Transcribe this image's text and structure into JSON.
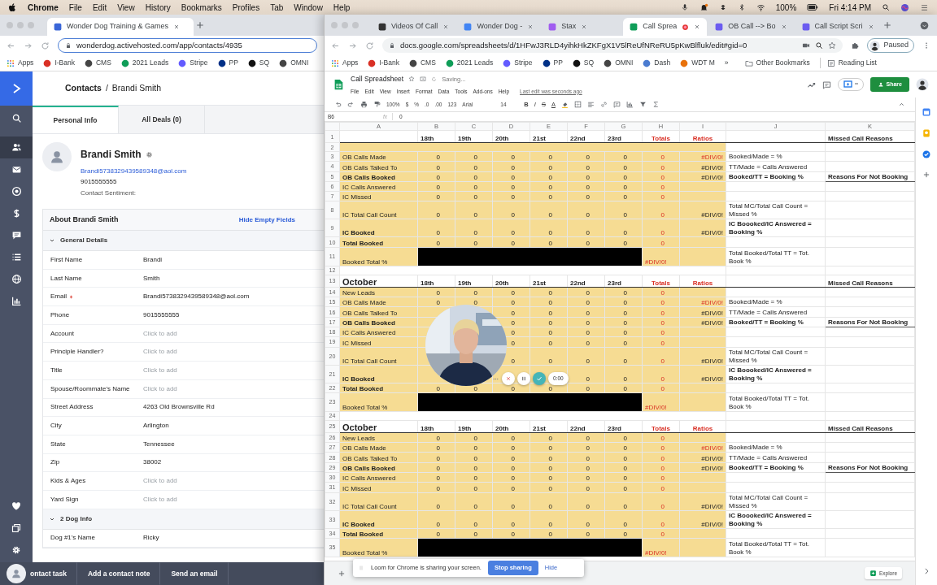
{
  "menubar": {
    "app": "Chrome",
    "menus": [
      "File",
      "Edit",
      "View",
      "History",
      "Bookmarks",
      "Profiles",
      "Tab",
      "Window",
      "Help"
    ],
    "battery": "100%",
    "clock": "Fri 4:14 PM"
  },
  "left_window": {
    "tabs": [
      {
        "title": "Wonder Dog Training & Games",
        "selected": true
      }
    ],
    "url": "wonderdog.activehosted.com/app/contacts/4935",
    "bookmarks": [
      {
        "label": "Apps",
        "kind": "apps"
      },
      {
        "label": "I-Bank",
        "kind": "site",
        "color": "#d93025"
      },
      {
        "label": "CMS",
        "kind": "site",
        "color": "#444444"
      },
      {
        "label": "2021 Leads",
        "kind": "site",
        "color": "#0f9d58"
      },
      {
        "label": "Stripe",
        "kind": "site",
        "color": "#635bff"
      },
      {
        "label": "PP",
        "kind": "site",
        "color": "#003087"
      },
      {
        "label": "SQ",
        "kind": "site",
        "color": "#111111"
      },
      {
        "label": "OMNI",
        "kind": "site",
        "color": "#444444"
      }
    ],
    "breadcrumb": {
      "parent": "Contacts",
      "separator": "/",
      "current": "Brandi Smith"
    },
    "nav_tabs": [
      {
        "label": "Personal Info",
        "selected": true
      },
      {
        "label": "All Deals (0)",
        "selected": false
      }
    ],
    "contact": {
      "name": "Brandi Smith",
      "email": "Brandi5738329439589348@aol.com",
      "phone": "9015555555",
      "sentiment": "Contact Sentiment:"
    },
    "about": {
      "title": "About Brandi Smith",
      "action": "Hide Empty Fields"
    },
    "sections": [
      {
        "title": "General Details",
        "expanded": true,
        "fields": [
          {
            "label": "First Name",
            "value": "Brandi",
            "required": false
          },
          {
            "label": "Last Name",
            "value": "Smith",
            "required": false
          },
          {
            "label": "Email",
            "value": "Brandi5738329439589348@aol.com",
            "required": true
          },
          {
            "label": "Phone",
            "value": "9015555555",
            "required": false
          },
          {
            "label": "Account",
            "placeholder": "Click to add",
            "required": false
          },
          {
            "label": "Principle Handler?",
            "placeholder": "Click to add",
            "required": false
          },
          {
            "label": "Title",
            "placeholder": "Click to add",
            "required": false
          },
          {
            "label": "Spouse/Roommate's Name",
            "placeholder": "Click to add",
            "required": false
          },
          {
            "label": "Street Address",
            "value": "4263 Old Brownsville Rd",
            "required": false
          },
          {
            "label": "City",
            "value": "Arlington",
            "required": false
          },
          {
            "label": "State",
            "value": "Tennessee",
            "required": false
          },
          {
            "label": "Zip",
            "value": "38002",
            "required": false
          },
          {
            "label": "Kids & Ages",
            "placeholder": "Click to add",
            "required": false
          },
          {
            "label": "Yard Sign",
            "placeholder": "Click to add",
            "required": false
          }
        ]
      },
      {
        "title": "2 Dog Info",
        "expanded": true,
        "fields": [
          {
            "label": "Dog #1's Name",
            "value": "Ricky",
            "required": false
          }
        ]
      }
    ],
    "footer_actions": [
      "ontact task",
      "Add a contact note",
      "Send an email"
    ]
  },
  "right_window": {
    "tabs": [
      {
        "title": "Videos Of Call",
        "selected": false,
        "recording": false
      },
      {
        "title": "Wonder Dog -",
        "selected": false,
        "recording": false
      },
      {
        "title": "Stax",
        "selected": false,
        "recording": false
      },
      {
        "title": "Call Sprea",
        "selected": true,
        "recording": true
      },
      {
        "title": "OB Call --> Bo",
        "selected": false,
        "recording": false
      },
      {
        "title": "Call Script Scri",
        "selected": false,
        "recording": false
      }
    ],
    "url": "docs.google.com/spreadsheets/d/1HFwJ3RLD4yihkHkZKFgX1V5lReUfNReRU5pKwBlfluk/edit#gid=0",
    "profile_status": "Paused",
    "bookmarks": [
      {
        "label": "Apps",
        "kind": "apps"
      },
      {
        "label": "I-Bank",
        "kind": "site",
        "color": "#d93025"
      },
      {
        "label": "CMS",
        "kind": "site",
        "color": "#444444"
      },
      {
        "label": "2021 Leads",
        "kind": "site",
        "color": "#0f9d58"
      },
      {
        "label": "Stripe",
        "kind": "site",
        "color": "#635bff"
      },
      {
        "label": "PP",
        "kind": "site",
        "color": "#003087"
      },
      {
        "label": "SQ",
        "kind": "site",
        "color": "#111111"
      },
      {
        "label": "OMNI",
        "kind": "site",
        "color": "#444444"
      },
      {
        "label": "Dash",
        "kind": "site",
        "color": "#4a7bd0"
      },
      {
        "label": "WDT M",
        "kind": "site",
        "color": "#e8710a"
      }
    ],
    "more_bookmarks": "»",
    "other_bookmarks": "Other Bookmarks",
    "reading_list": "Reading List",
    "sheet": {
      "title": "Call Spreadsheet",
      "status": "Saving...",
      "menus": [
        "File",
        "Edit",
        "View",
        "Insert",
        "Format",
        "Data",
        "Tools",
        "Add-ons",
        "Help"
      ],
      "last_edit": "Last edit was seconds ago",
      "share": "Share",
      "toolbar": {
        "zoom": "100%",
        "formats": [
          "$",
          "%",
          ".0",
          ".00",
          "123"
        ],
        "font": "Arial",
        "size": "14",
        "styles": [
          "B",
          "I",
          "S",
          "A"
        ]
      },
      "cell_ref": "B6",
      "fx": "fx",
      "formula": "0",
      "columns": [
        "A",
        "B",
        "C",
        "D",
        "E",
        "F",
        "G",
        "H",
        "I",
        "J",
        "K"
      ],
      "rows": [
        {
          "kind": "header",
          "n": "1",
          "days": [
            "18th",
            "19th",
            "20th",
            "21st",
            "22nd",
            "23rd"
          ],
          "totals": "Totals",
          "ratios": "Ratios",
          "reason": "Missed Call Reasons"
        },
        {
          "kind": "blank",
          "n": "2",
          "shaded": true
        },
        {
          "kind": "data",
          "n": "3",
          "label": "OB Calls Made",
          "bold": false,
          "values": [
            "0",
            "0",
            "0",
            "0",
            "0",
            "0"
          ],
          "total": "0",
          "ratio": "#DIV/0!",
          "ratio_alert": true,
          "note": "Booked/Made = %",
          "note_bold": false
        },
        {
          "kind": "data",
          "n": "4",
          "label": "OB Calls Talked To",
          "bold": false,
          "values": [
            "0",
            "0",
            "0",
            "0",
            "0",
            "0"
          ],
          "total": "0",
          "ratio": "#DIV/0!",
          "ratio_alert": false,
          "note": "TT/Made = Calls Answered",
          "note_bold": false
        },
        {
          "kind": "data",
          "n": "5",
          "label": "OB Calls Booked",
          "bold": true,
          "values": [
            "0",
            "0",
            "0",
            "0",
            "0",
            "0"
          ],
          "total": "0",
          "ratio": "#DIV/0!",
          "ratio_alert": false,
          "note": "Booked/TT = Booking %",
          "note_bold": true,
          "reason": "Reasons For Not Booking"
        },
        {
          "kind": "data",
          "n": "6",
          "label": "IC Calls Answered",
          "bold": false,
          "values": [
            "0",
            "0",
            "0",
            "0",
            "0",
            "0"
          ],
          "total": "0"
        },
        {
          "kind": "data",
          "n": "7",
          "label": "IC Missed",
          "bold": false,
          "values": [
            "0",
            "0",
            "0",
            "0",
            "0",
            "0"
          ],
          "total": "0"
        },
        {
          "kind": "tall",
          "n": "8",
          "label": "IC Total Call Count",
          "bold": false,
          "values": [
            "0",
            "0",
            "0",
            "0",
            "0",
            "0"
          ],
          "total": "0",
          "ratio": "#DIV/0!",
          "ratio_alert": false,
          "note": "Total MC/Total Call Count = Missed %",
          "note_bold": false
        },
        {
          "kind": "tall",
          "n": "9",
          "label": "IC Booked",
          "bold": true,
          "values": [
            "0",
            "0",
            "0",
            "0",
            "0",
            "0"
          ],
          "total": "0",
          "ratio": "#DIV/0!",
          "ratio_alert": false,
          "note": "IC Boooked/IC Answered = Booking %",
          "note_bold": true
        },
        {
          "kind": "data",
          "n": "10",
          "label": "Total Booked",
          "bold": true,
          "values": [
            "0",
            "0",
            "0",
            "0",
            "0",
            "0"
          ],
          "total": "0"
        },
        {
          "kind": "percent",
          "n": "11",
          "label": "Booked Total %",
          "total": "#DIV/0!",
          "note": "Total Booked/Total TT = Tot. Book %"
        },
        {
          "kind": "blank",
          "n": "12",
          "shaded": false
        },
        {
          "kind": "header",
          "n": "13",
          "month": "October",
          "days": [
            "18th",
            "19th",
            "20th",
            "21st",
            "22nd",
            "23rd"
          ],
          "totals": "Totals",
          "ratios": "Ratios",
          "reason": "Missed Call Reasons"
        },
        {
          "kind": "data",
          "n": "14",
          "label": "New Leads",
          "bold": false,
          "values": [
            "0",
            "0",
            "0",
            "0",
            "0",
            "0"
          ],
          "total": "0"
        },
        {
          "kind": "data",
          "n": "15",
          "label": "OB Calls Made",
          "bold": false,
          "values": [
            "0",
            "0",
            "0",
            "0",
            "0",
            "0"
          ],
          "total": "0",
          "ratio": "#DIV/0!",
          "ratio_alert": true,
          "note": "Booked/Made = %",
          "note_bold": false
        },
        {
          "kind": "data",
          "n": "16",
          "label": "OB Calls Talked To",
          "bold": false,
          "values": [
            "0",
            "0",
            "0",
            "0"
          ],
          "total": "0",
          "ratio": "#DIV/0!",
          "ratio_alert": false,
          "note": "TT/Made = Calls Answered",
          "note_bold": false
        },
        {
          "kind": "data",
          "n": "17",
          "label": "OB Calls Booked",
          "bold": true,
          "values": [
            "0",
            "0",
            "0",
            "0"
          ],
          "total": "0",
          "ratio": "#DIV/0!",
          "ratio_alert": false,
          "note": "Booked/TT = Booking %",
          "note_bold": true,
          "reason": "Reasons For Not Booking"
        },
        {
          "kind": "data",
          "n": "18",
          "label": "IC Calls Answered",
          "bold": false,
          "values": [
            "0",
            "0",
            "0",
            "0"
          ],
          "total": "0"
        },
        {
          "kind": "data",
          "n": "19",
          "label": "IC Missed",
          "bold": false,
          "values": [
            "0",
            "0",
            "0",
            "0"
          ],
          "total": "0"
        },
        {
          "kind": "tall",
          "n": "20",
          "label": "IC Total Call Count",
          "bold": false,
          "values": [
            "0",
            "0",
            "0",
            "0"
          ],
          "total": "0",
          "ratio": "#DIV/0!",
          "ratio_alert": false,
          "note": "Total MC/Total Call Count = Missed %",
          "note_bold": false
        },
        {
          "kind": "tall",
          "n": "21",
          "label": "IC Booked",
          "bold": true,
          "values": [
            "0",
            "0"
          ],
          "total": "0",
          "ratio": "#DIV/0!",
          "ratio_alert": false,
          "note": "IC Boooked/IC Answered = Booking %",
          "note_bold": true
        },
        {
          "kind": "data",
          "n": "22",
          "label": "Total Booked",
          "bold": true,
          "values": [
            "0",
            "0",
            "0",
            "0",
            "0",
            "0"
          ],
          "total": "0"
        },
        {
          "kind": "percent",
          "n": "23",
          "label": "Booked Total %",
          "total": "#DIV/0!",
          "note": "Total Booked/Total TT = Tot. Book %"
        },
        {
          "kind": "blank",
          "n": "24",
          "shaded": false
        },
        {
          "kind": "header",
          "n": "25",
          "month": "October",
          "days": [
            "18th",
            "19th",
            "20th",
            "21st",
            "22nd",
            "23rd"
          ],
          "totals": "Totals",
          "ratios": "Ratios",
          "reason": "Missed Call Reasons"
        },
        {
          "kind": "data",
          "n": "26",
          "label": "New Leads",
          "bold": false,
          "values": [
            "0",
            "0",
            "0",
            "0",
            "0",
            "0"
          ],
          "total": "0"
        },
        {
          "kind": "data",
          "n": "27",
          "label": "OB Calls Made",
          "bold": false,
          "values": [
            "0",
            "0",
            "0",
            "0",
            "0",
            "0"
          ],
          "total": "0",
          "ratio": "#DIV/0!",
          "ratio_alert": true,
          "note": "Booked/Made = %",
          "note_bold": false
        },
        {
          "kind": "data",
          "n": "28",
          "label": "OB Calls Talked To",
          "bold": false,
          "values": [
            "0",
            "0",
            "0",
            "0",
            "0",
            "0"
          ],
          "total": "0",
          "ratio": "#DIV/0!",
          "ratio_alert": false,
          "note": "TT/Made = Calls Answered",
          "note_bold": false
        },
        {
          "kind": "data",
          "n": "29",
          "label": "OB Calls Booked",
          "bold": true,
          "values": [
            "0",
            "0",
            "0",
            "0",
            "0",
            "0"
          ],
          "total": "0",
          "ratio": "#DIV/0!",
          "ratio_alert": false,
          "note": "Booked/TT = Booking %",
          "note_bold": true,
          "reason": "Reasons For Not Booking"
        },
        {
          "kind": "data",
          "n": "30",
          "label": "IC Calls Answered",
          "bold": false,
          "values": [
            "0",
            "0",
            "0",
            "0",
            "0",
            "0"
          ],
          "total": "0"
        },
        {
          "kind": "data",
          "n": "31",
          "label": "IC Missed",
          "bold": false,
          "values": [
            "0",
            "0",
            "0",
            "0",
            "0",
            "0"
          ],
          "total": "0"
        },
        {
          "kind": "tall",
          "n": "32",
          "label": "IC Total Call Count",
          "bold": false,
          "values": [
            "0",
            "0",
            "0",
            "0",
            "0",
            "0"
          ],
          "total": "0",
          "ratio": "#DIV/0!",
          "ratio_alert": false,
          "note": "Total MC/Total Call Count = Missed %",
          "note_bold": false
        },
        {
          "kind": "tall",
          "n": "33",
          "label": "IC Booked",
          "bold": true,
          "values": [
            "0",
            "0",
            "0",
            "0",
            "0",
            "0"
          ],
          "total": "0",
          "ratio": "#DIV/0!",
          "ratio_alert": false,
          "note": "IC Boooked/IC Answered = Booking %",
          "note_bold": true
        },
        {
          "kind": "data",
          "n": "34",
          "label": "Total Booked",
          "bold": true,
          "values": [
            "0",
            "0",
            "0",
            "0",
            "0",
            "0"
          ],
          "total": "0"
        },
        {
          "kind": "percent",
          "n": "35",
          "label": "Booked Total %",
          "total": "#DIV/0!",
          "note": "Total Booked/Total TT = Tot. Book %"
        }
      ],
      "explore": "Explore"
    },
    "camera": {
      "kind": "picture",
      "timer": "0:00"
    },
    "loom": {
      "message": "Loom for Chrome is sharing your screen.",
      "stop": "Stop sharing",
      "hide": "Hide"
    }
  }
}
